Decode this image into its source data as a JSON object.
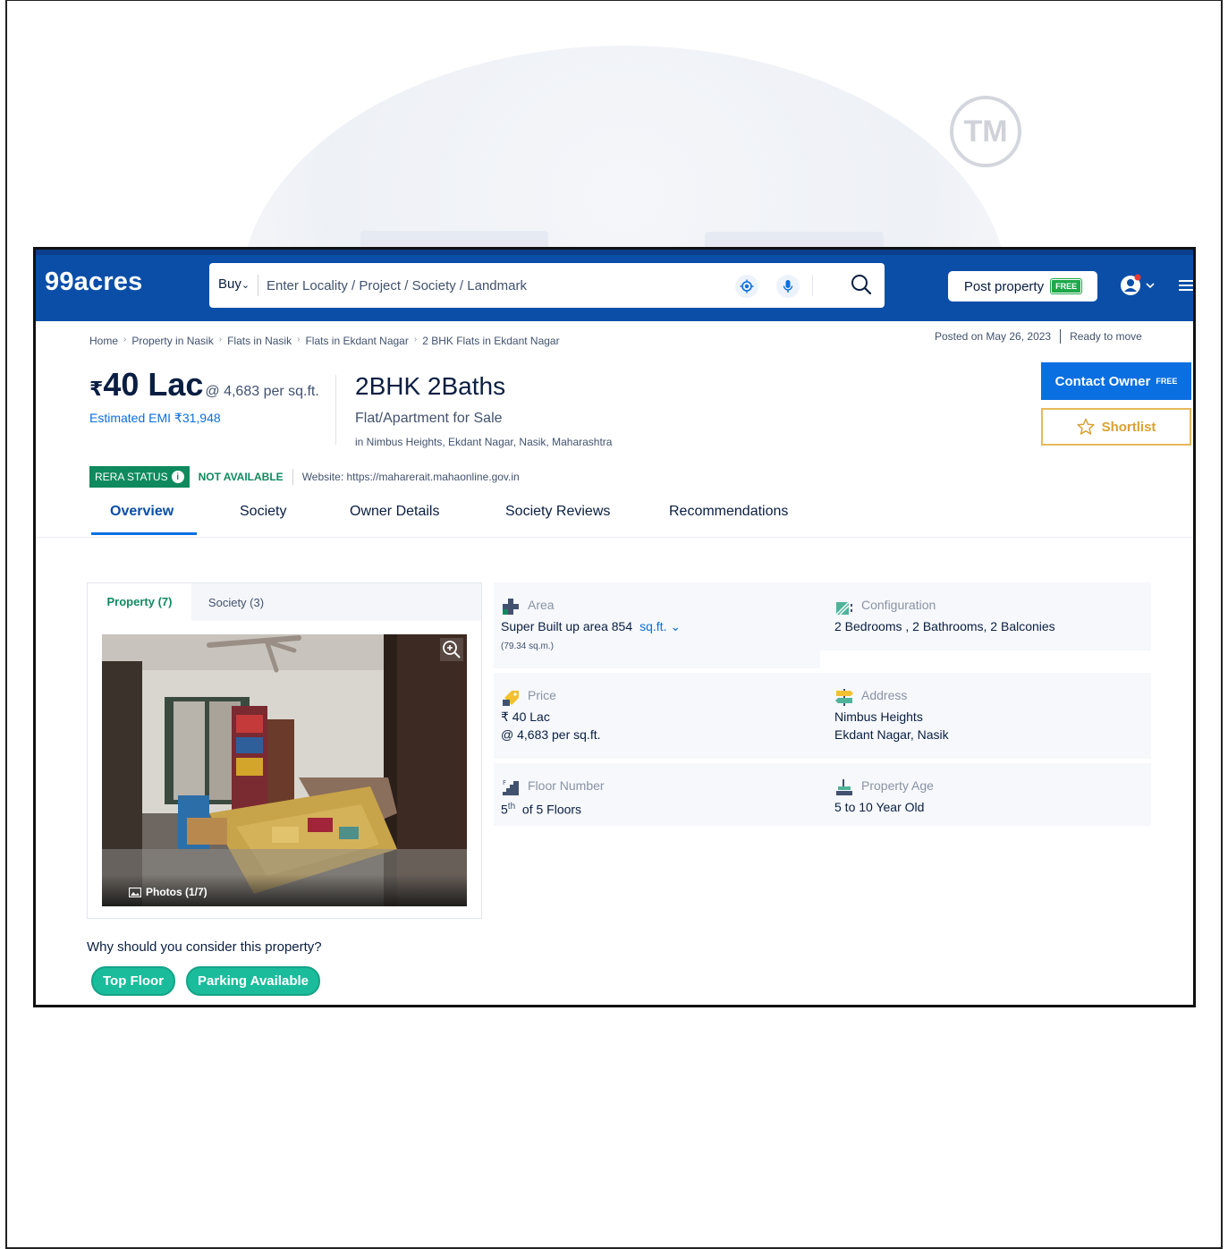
{
  "header": {
    "logo": "99acres",
    "search_mode": "Buy",
    "search_placeholder": "Enter Locality / Project / Society / Landmark",
    "post_property": "Post property",
    "post_badge": "FREE"
  },
  "breadcrumb": [
    "Home",
    "Property in Nasik",
    "Flats in Nasik",
    "Flats in Ekdant Nagar",
    "2 BHK Flats in Ekdant Nagar"
  ],
  "meta": {
    "posted": "Posted on May 26, 2023",
    "status": "Ready to move"
  },
  "listing": {
    "price_symbol": "₹",
    "price": "40 Lac",
    "price_per": "@ 4,683 per sq.ft.",
    "emi": "Estimated EMI ₹31,948",
    "title": "2BHK 2Baths",
    "subtitle": "Flat/Apartment for Sale",
    "location": "in Nimbus Heights, Ekdant Nagar, Nasik, Maharashtra",
    "contact_label": "Contact Owner",
    "contact_badge": "FREE",
    "shortlist_label": "Shortlist"
  },
  "rera": {
    "label": "RERA STATUS",
    "status": "NOT AVAILABLE",
    "website": "Website: https://maharerait.mahaonline.gov.in"
  },
  "tabs": [
    "Overview",
    "Society",
    "Owner Details",
    "Society Reviews",
    "Recommendations"
  ],
  "gallery": {
    "tab_property": "Property (7)",
    "tab_society": "Society (3)",
    "photos_label": "Photos (1/7)"
  },
  "details": {
    "area_label": "Area",
    "area_value": "Super Built up area 854",
    "area_unit": "sq.ft.",
    "area_sqm": "(79.34 sq.m.)",
    "config_label": "Configuration",
    "config_value": "2 Bedrooms , 2 Bathrooms, 2 Balconies",
    "price_label": "Price",
    "price_value": "₹ 40 Lac",
    "price_per": "@ 4,683 per sq.ft.",
    "address_label": "Address",
    "address_line1": "Nimbus Heights",
    "address_line2": "Ekdant Nagar, Nasik",
    "floor_label": "Floor Number",
    "floor_value": "5",
    "floor_sup": "th",
    "floor_of": "of 5 Floors",
    "age_label": "Property Age",
    "age_value": "5 to 10 Year Old"
  },
  "why": {
    "heading": "Why should you consider this property?",
    "chips": [
      "Top Floor",
      "Parking Available"
    ]
  },
  "watermark": "TM",
  "colors": {
    "brand_blue": "#0a4ea8",
    "link_blue": "#0a6fe1",
    "rera_green": "#0f8a5f",
    "chip_green": "#1abc9c",
    "shortlist_gold": "#d9a233"
  }
}
